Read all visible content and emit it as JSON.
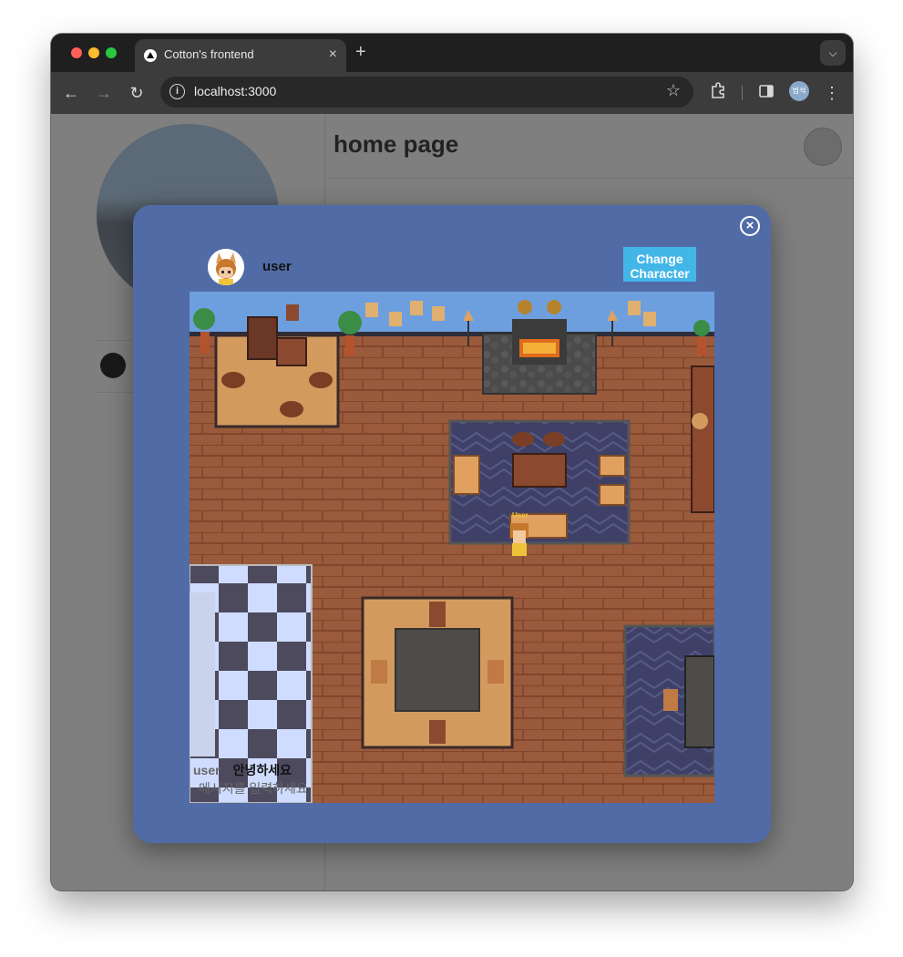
{
  "browser": {
    "tab_title": "Cotton's frontend",
    "tab_close": "×",
    "new_tab": "+",
    "url": "localhost:3000",
    "profile_initials": "범석"
  },
  "page": {
    "title": "home page"
  },
  "modal": {
    "close_icon": "×",
    "user_name": "user",
    "change_button": "Change Character",
    "player_label": "User",
    "chat": {
      "nickname": "user",
      "message": "안녕하세요",
      "input_placeholder": "메시지를 입력하세요"
    }
  },
  "colors": {
    "modal_bg": "#516ba6",
    "button_bg": "#43b6e8",
    "floor": "#9a5a3c",
    "wall": "#6d9fdf"
  }
}
